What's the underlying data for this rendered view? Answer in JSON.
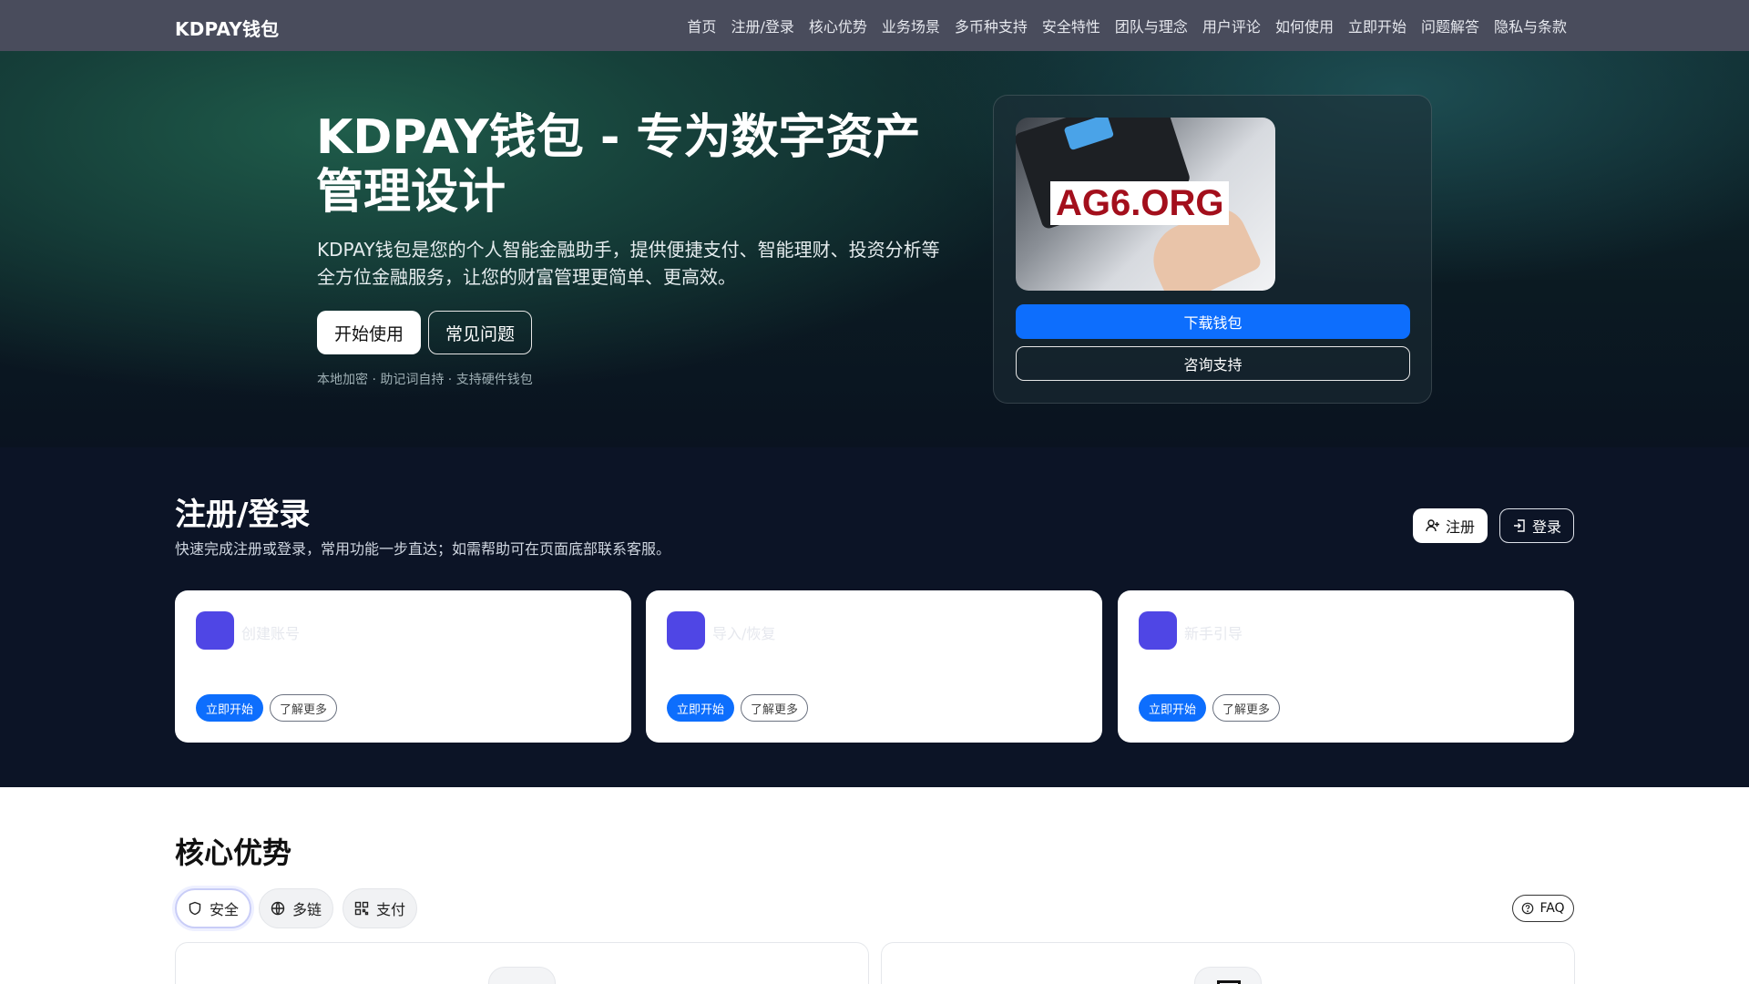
{
  "nav": {
    "brand": "KDPAY钱包",
    "links": [
      "首页",
      "注册/登录",
      "核心优势",
      "业务场景",
      "多币种支持",
      "安全特性",
      "团队与理念",
      "用户评论",
      "如何使用",
      "立即开始",
      "问题解答",
      "隐私与条款"
    ]
  },
  "hero": {
    "title": "KDPAY钱包 - 专为数字资产管理设计",
    "description": "KDPAY钱包是您的个人智能金融助手，提供便捷支付、智能理财、投资分析等全方位金融服务，让您的财富管理更简单、更高效。",
    "primary_button": "开始使用",
    "secondary_button": "常见问题",
    "note": "本地加密 · 助记词自持 · 支持硬件钱包",
    "promo_text": "AG6.ORG",
    "download_button": "下载钱包",
    "support_button": "咨询支持"
  },
  "register": {
    "title": "注册/登录",
    "subtitle": "快速完成注册或登录，常用功能一步直达；如需帮助可在页面底部联系客服。",
    "signup_button": "注册",
    "login_button": "登录",
    "cards": [
      {
        "title": "创建账号",
        "start": "立即开始",
        "more": "了解更多"
      },
      {
        "title": "导入/恢复",
        "start": "立即开始",
        "more": "了解更多"
      },
      {
        "title": "新手引导",
        "start": "立即开始",
        "more": "了解更多"
      }
    ]
  },
  "advantages": {
    "title": "核心优势",
    "tabs": [
      {
        "label": "安全",
        "icon": "shield-icon"
      },
      {
        "label": "多链",
        "icon": "globe-icon"
      },
      {
        "label": "支付",
        "icon": "qr-code-icon"
      }
    ],
    "faq_button": "FAQ"
  },
  "colors": {
    "nav_bg": "#494c5c",
    "accent_blue": "#0d6efd",
    "card_icon": "#4f46e5",
    "section_dark": "#0c1426"
  }
}
